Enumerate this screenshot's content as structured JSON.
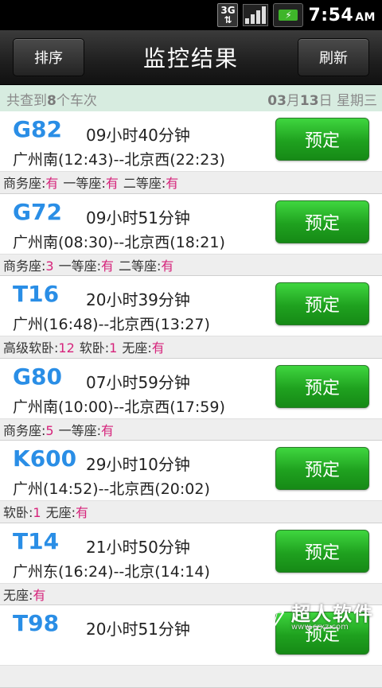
{
  "status_bar": {
    "network": "3G",
    "time": "7:54",
    "ampm": "AM"
  },
  "title_bar": {
    "left_button": "排序",
    "title": "监控结果",
    "right_button": "刷新"
  },
  "summary": {
    "prefix": "共查到",
    "count": "8",
    "suffix": "个车次",
    "date_month": "03",
    "date_day": "13",
    "weekday": "星期三"
  },
  "trains": [
    {
      "no": "G82",
      "duration": "09小时40分钟",
      "route": "广州南(12:43)--北京西(22:23)",
      "book": "预定",
      "seats": [
        {
          "name": "商务座",
          "count": "有"
        },
        {
          "name": "一等座",
          "count": "有"
        },
        {
          "name": "二等座",
          "count": "有"
        }
      ]
    },
    {
      "no": "G72",
      "duration": "09小时51分钟",
      "route": "广州南(08:30)--北京西(18:21)",
      "book": "预定",
      "seats": [
        {
          "name": "商务座",
          "count": "3"
        },
        {
          "name": "一等座",
          "count": "有"
        },
        {
          "name": "二等座",
          "count": "有"
        }
      ]
    },
    {
      "no": "T16",
      "duration": "20小时39分钟",
      "route": "广州(16:48)--北京西(13:27)",
      "book": "预定",
      "seats": [
        {
          "name": "高级软卧",
          "count": "12"
        },
        {
          "name": "软卧",
          "count": "1"
        },
        {
          "name": "无座",
          "count": "有"
        }
      ]
    },
    {
      "no": "G80",
      "duration": "07小时59分钟",
      "route": "广州南(10:00)--北京西(17:59)",
      "book": "预定",
      "seats": [
        {
          "name": "商务座",
          "count": "5"
        },
        {
          "name": "一等座",
          "count": "有"
        }
      ]
    },
    {
      "no": "K600",
      "duration": "29小时10分钟",
      "route": "广州(14:52)--北京西(20:02)",
      "book": "预定",
      "seats": [
        {
          "name": "软卧",
          "count": "1"
        },
        {
          "name": "无座",
          "count": "有"
        }
      ]
    },
    {
      "no": "T14",
      "duration": "21小时50分钟",
      "route": "广州东(16:24)--北京(14:14)",
      "book": "预定",
      "seats": [
        {
          "name": "无座",
          "count": "有"
        }
      ]
    },
    {
      "no": "T98",
      "duration": "20小时51分钟",
      "route": "",
      "book": "预定",
      "seats": []
    }
  ],
  "watermark": {
    "text": "超人软件",
    "url": "www.crxz.com"
  }
}
